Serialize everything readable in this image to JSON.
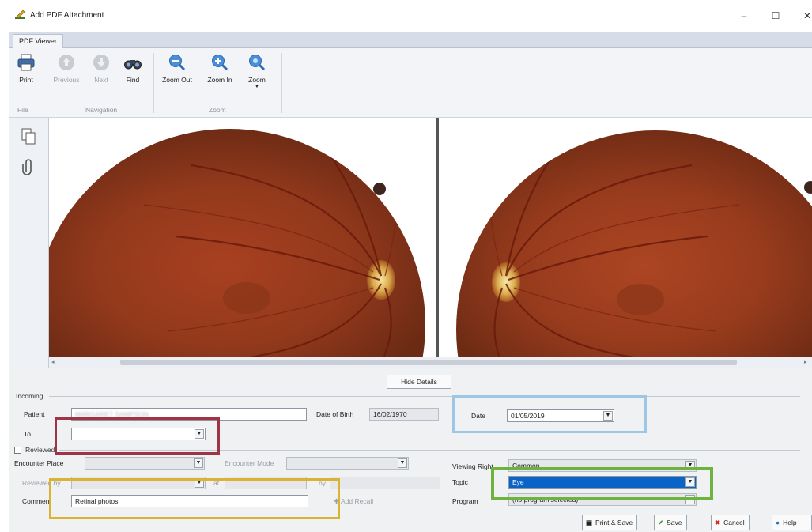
{
  "window": {
    "title": "Add PDF Attachment",
    "controls": {
      "minimize": "–",
      "maximize": "☐",
      "close": "✕"
    }
  },
  "ribbon": {
    "tab": "PDF Viewer",
    "buttons": {
      "print": "Print",
      "previous": "Previous",
      "next": "Next",
      "find": "Find",
      "zoom_out": "Zoom Out",
      "zoom_in": "Zoom In",
      "zoom": "Zoom"
    },
    "groups": {
      "file": "File",
      "navigation": "Navigation",
      "zoom": "Zoom"
    }
  },
  "details": {
    "hide_details": "Hide Details",
    "incoming_legend": "Incoming",
    "patient_label": "Patient",
    "patient_value": "MARGARET SAMPSON",
    "dob_label": "Date of Birth",
    "dob_value": "16/02/1970",
    "date_label": "Date",
    "date_value": "01/05/2019",
    "to_label": "To",
    "to_value": "",
    "reviewed_label": "Reviewed",
    "encounter_place_label": "Encounter Place",
    "encounter_mode_label": "Encounter Mode",
    "reviewed_by_label": "Reviewed by",
    "at_label": "at",
    "by_label": "by",
    "comment_label": "Comment",
    "comment_value": "Retinal photos",
    "add_recall": "Add Recall",
    "viewing_right_label": "Viewing Right",
    "viewing_right_value": "Common",
    "topic_label": "Topic",
    "topic_value": "Eye",
    "program_label": "Program",
    "program_value": "(no program selected)"
  },
  "actions": {
    "print_save": "Print & Save",
    "save": "Save",
    "cancel": "Cancel",
    "help": "Help"
  },
  "highlight_colors": {
    "to": "#9e3446",
    "date": "#9cc8e6",
    "topic": "#6fb33f",
    "comment": "#dcb233"
  }
}
